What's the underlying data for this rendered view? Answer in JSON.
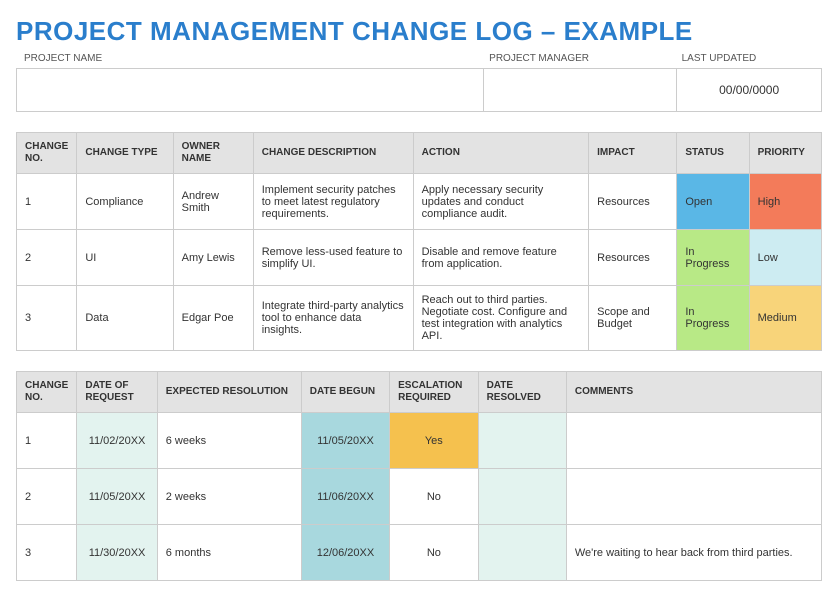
{
  "title": "PROJECT MANAGEMENT CHANGE LOG – EXAMPLE",
  "meta": {
    "labels": {
      "project_name": "PROJECT NAME",
      "project_manager": "PROJECT MANAGER",
      "last_updated": "LAST UPDATED"
    },
    "values": {
      "project_name": "",
      "project_manager": "",
      "last_updated": "00/00/0000"
    }
  },
  "table1": {
    "headers": {
      "no": "CHANGE NO.",
      "type": "CHANGE TYPE",
      "owner": "OWNER NAME",
      "desc": "CHANGE DESCRIPTION",
      "action": "ACTION",
      "impact": "IMPACT",
      "status": "STATUS",
      "priority": "PRIORITY"
    },
    "rows": [
      {
        "no": "1",
        "type": "Compliance",
        "owner": "Andrew Smith",
        "desc": "Implement security patches to meet latest regulatory requirements.",
        "action": "Apply necessary security updates and conduct compliance audit.",
        "impact": "Resources",
        "status": "Open",
        "status_class": "c-blue",
        "priority": "High",
        "priority_class": "c-red"
      },
      {
        "no": "2",
        "type": "UI",
        "owner": "Amy Lewis",
        "desc": "Remove less-used feature to simplify UI.",
        "action": "Disable and remove feature from application.",
        "impact": "Resources",
        "status": "In Progress",
        "status_class": "c-green",
        "priority": "Low",
        "priority_class": "c-lblue"
      },
      {
        "no": "3",
        "type": "Data",
        "owner": "Edgar Poe",
        "desc": "Integrate third-party analytics tool to enhance data insights.",
        "action": "Reach out to third parties. Negotiate cost. Configure and test integration with analytics API.",
        "impact": "Scope and Budget",
        "status": "In Progress",
        "status_class": "c-green",
        "priority": "Medium",
        "priority_class": "c-yellow"
      }
    ]
  },
  "table2": {
    "headers": {
      "no": "CHANGE NO.",
      "dor": "DATE OF REQUEST",
      "res": "EXPECTED RESOLUTION",
      "begun": "DATE BEGUN",
      "esc": "ESCALATION REQUIRED",
      "resolved": "DATE RESOLVED",
      "comments": "COMMENTS"
    },
    "rows": [
      {
        "no": "1",
        "dor": "11/02/20XX",
        "res": "6 weeks",
        "begun": "11/05/20XX",
        "esc": "Yes",
        "esc_class": "c-amber",
        "resolved": "",
        "comments": ""
      },
      {
        "no": "2",
        "dor": "11/05/20XX",
        "res": "2 weeks",
        "begun": "11/06/20XX",
        "esc": "No",
        "esc_class": "",
        "resolved": "",
        "comments": ""
      },
      {
        "no": "3",
        "dor": "11/30/20XX",
        "res": "6 months",
        "begun": "12/06/20XX",
        "esc": "No",
        "esc_class": "",
        "resolved": "",
        "comments": "We're waiting to hear back from third parties."
      }
    ]
  }
}
